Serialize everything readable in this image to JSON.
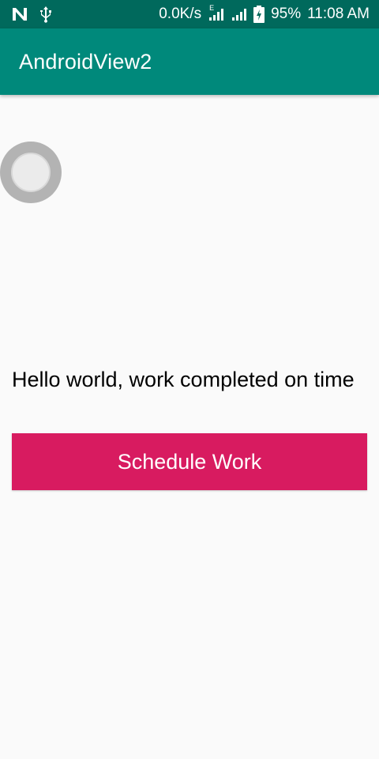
{
  "status_bar": {
    "icons_left": [
      "n-icon",
      "usb-icon"
    ],
    "network_speed": "0.0K/s",
    "network_type": "E",
    "battery_percent": "95%",
    "time": "11:08 AM",
    "background": "#00695c"
  },
  "app_bar": {
    "title": "AndroidView2",
    "background": "#00897b"
  },
  "main": {
    "radio_checked": false,
    "message": "Hello world, work completed on time",
    "button_label": "Schedule Work",
    "button_color": "#d81b60"
  }
}
